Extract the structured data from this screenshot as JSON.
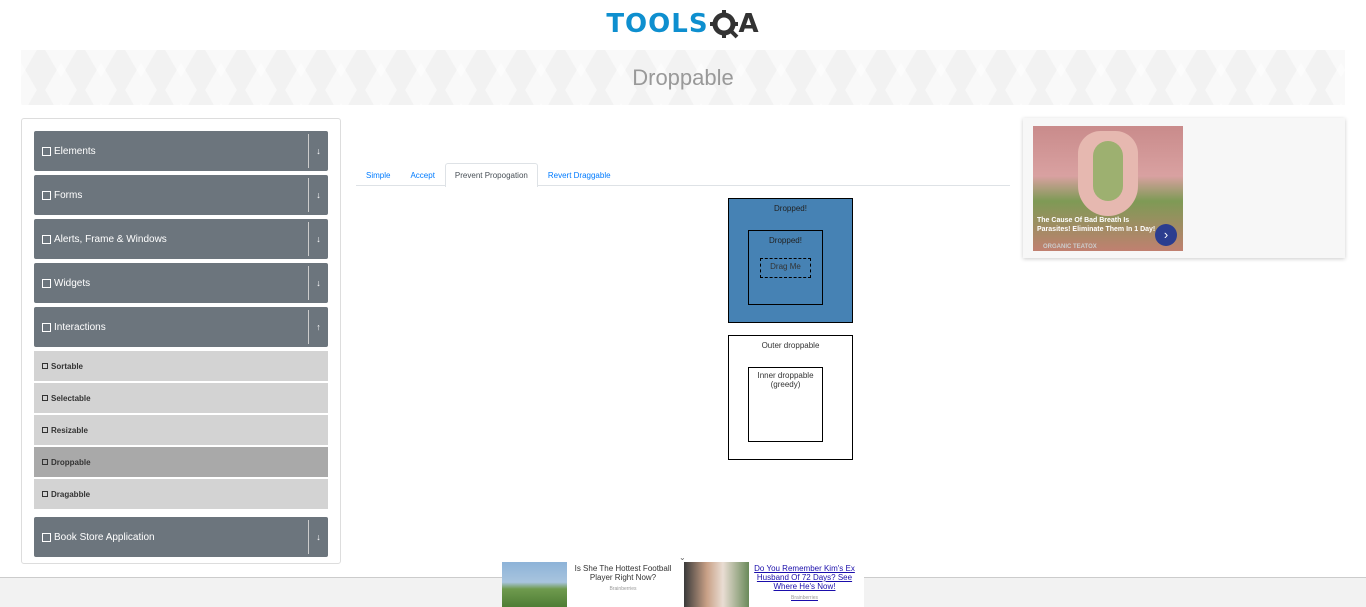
{
  "logo": {
    "part1": "TOOLS",
    "part2": "QA"
  },
  "page_title": "Droppable",
  "sidebar": {
    "groups": [
      {
        "label": "Elements",
        "icon": "menu-icon",
        "toggle": "↓"
      },
      {
        "label": "Forms",
        "icon": "form-icon",
        "toggle": "↓"
      },
      {
        "label": "Alerts, Frame & Windows",
        "icon": "window-icon",
        "toggle": "↓"
      },
      {
        "label": "Widgets",
        "icon": "grid-icon",
        "toggle": "↓"
      },
      {
        "label": "Interactions",
        "icon": "interaction-icon",
        "toggle": "↑"
      }
    ],
    "items": [
      {
        "label": "Sortable"
      },
      {
        "label": "Selectable"
      },
      {
        "label": "Resizable"
      },
      {
        "label": "Droppable"
      },
      {
        "label": "Dragabble"
      }
    ],
    "book_store": {
      "label": "Book Store Application",
      "toggle": "↓"
    }
  },
  "tabs": [
    "Simple",
    "Accept",
    "Prevent Propogation",
    "Revert Draggable"
  ],
  "greedy_demo": {
    "outer_dropped_label": "Dropped!",
    "inner_dropped_label": "Dropped!",
    "drag_label": "Drag Me",
    "outer_label": "Outer droppable",
    "inner_label": "Inner droppable (greedy)"
  },
  "side_ad": {
    "caption": "The Cause Of Bad Breath Is Parasites! Eliminate Them In 1 Day!",
    "brand": "ORGANIC TEATOX",
    "arrow": "›"
  },
  "bottom_ad": {
    "close": "⌄",
    "text1": "Is She The Hottest Football Player Right Now?",
    "source1": "Brainberries",
    "text2": "Do You Remember Kim's Ex Husband Of 72 Days? See Where He's Now!",
    "source2": "Brainberries"
  },
  "colors": {
    "accent": "#007bff",
    "dropped": "#4682b4",
    "sidebar_header": "#6c757d",
    "logo_blue": "#0e8fcf"
  }
}
